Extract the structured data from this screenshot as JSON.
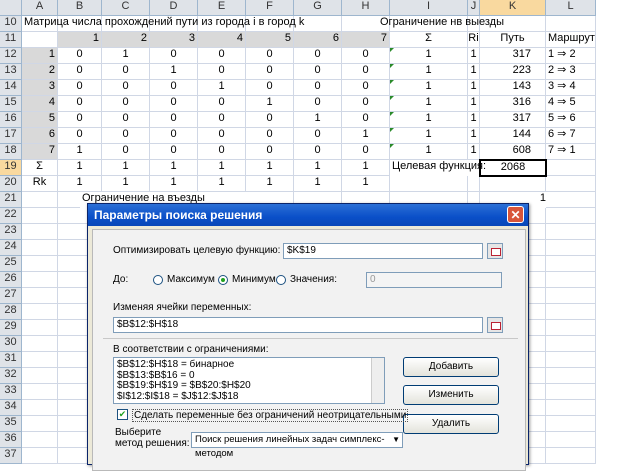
{
  "columns": [
    "A",
    "B",
    "C",
    "D",
    "E",
    "F",
    "G",
    "H",
    "I",
    "J",
    "K",
    "L"
  ],
  "row_numbers": [
    "10",
    "11",
    "12",
    "13",
    "14",
    "15",
    "16",
    "17",
    "18",
    "19",
    "20",
    "21",
    "22",
    "23",
    "24",
    "25",
    "26",
    "27",
    "28",
    "29",
    "30",
    "31",
    "32",
    "33",
    "34",
    "35",
    "36",
    "37"
  ],
  "title_matrix": "Матрица числа прохождений пути из города i в город k",
  "title_limit_exit": "Ограничение нв выезды",
  "header_row": {
    "b": "1",
    "c": "2",
    "d": "3",
    "e": "4",
    "f": "5",
    "g": "6",
    "h": "7",
    "i": "Σ",
    "j": "Ri",
    "k": "Путь",
    "l": "Маршрут"
  },
  "rows": [
    {
      "a": "1",
      "vals": [
        "0",
        "1",
        "0",
        "0",
        "0",
        "0",
        "0"
      ],
      "sum": "1",
      "ri": "1",
      "path": "317",
      "route": "1 ⇒ 2"
    },
    {
      "a": "2",
      "vals": [
        "0",
        "0",
        "1",
        "0",
        "0",
        "0",
        "0"
      ],
      "sum": "1",
      "ri": "1",
      "path": "223",
      "route": "2 ⇒ 3"
    },
    {
      "a": "3",
      "vals": [
        "0",
        "0",
        "0",
        "1",
        "0",
        "0",
        "0"
      ],
      "sum": "1",
      "ri": "1",
      "path": "143",
      "route": "3 ⇒ 4"
    },
    {
      "a": "4",
      "vals": [
        "0",
        "0",
        "0",
        "0",
        "1",
        "0",
        "0"
      ],
      "sum": "1",
      "ri": "1",
      "path": "316",
      "route": "4 ⇒ 5"
    },
    {
      "a": "5",
      "vals": [
        "0",
        "0",
        "0",
        "0",
        "0",
        "1",
        "0"
      ],
      "sum": "1",
      "ri": "1",
      "path": "317",
      "route": "5 ⇒ 6"
    },
    {
      "a": "6",
      "vals": [
        "0",
        "0",
        "0",
        "0",
        "0",
        "0",
        "1"
      ],
      "sum": "1",
      "ri": "1",
      "path": "144",
      "route": "6 ⇒ 7"
    },
    {
      "a": "7",
      "vals": [
        "1",
        "0",
        "0",
        "0",
        "0",
        "0",
        "0"
      ],
      "sum": "1",
      "ri": "1",
      "path": "608",
      "route": "7 ⇒ 1"
    }
  ],
  "sum_row": {
    "a": "Σ",
    "vals": [
      "1",
      "1",
      "1",
      "1",
      "1",
      "1",
      "1"
    ],
    "label": "Целевая функция:",
    "value": "2068"
  },
  "rk_row": {
    "a": "Rk",
    "vals": [
      "1",
      "1",
      "1",
      "1",
      "1",
      "1",
      "1"
    ]
  },
  "row21": {
    "label": "Ограничение на въезды",
    "value": "1"
  },
  "dialog": {
    "title": "Параметры поиска решения",
    "close": "✕",
    "objective_label": "Оптимизировать целевую функцию:",
    "objective_value": "$K$19",
    "to_label": "До:",
    "max_label": "Максимум",
    "min_label": "Минимум",
    "value_label": "Значения:",
    "value_field": "0",
    "changing_label": "Изменяя ячейки переменных:",
    "changing_value": "$B$12:$H$18",
    "constraints_label": "В соответствии с ограничениями:",
    "constraints": [
      "$B$12:$H$18 = бинарное",
      "$B$13:$B$16 = 0",
      "$B$19:$H$19 = $B$20:$H$20",
      "$I$12:$I$18 = $J$12:$J$18"
    ],
    "add_button": "Добавить",
    "change_button": "Изменить",
    "delete_button": "Удалить",
    "nonneg_label": "Сделать переменные без ограничений неотрицательными",
    "method_label_1": "Выберите",
    "method_label_2": "метод решения:",
    "method_value": "Поиск решения линейных задач симплекс-методом"
  },
  "colors": {
    "header_bg": "#dfe3e8",
    "selected_header": "#f9d99f",
    "dialog_title": "#0a4fc8",
    "marker_green": "#2a8a2a"
  }
}
